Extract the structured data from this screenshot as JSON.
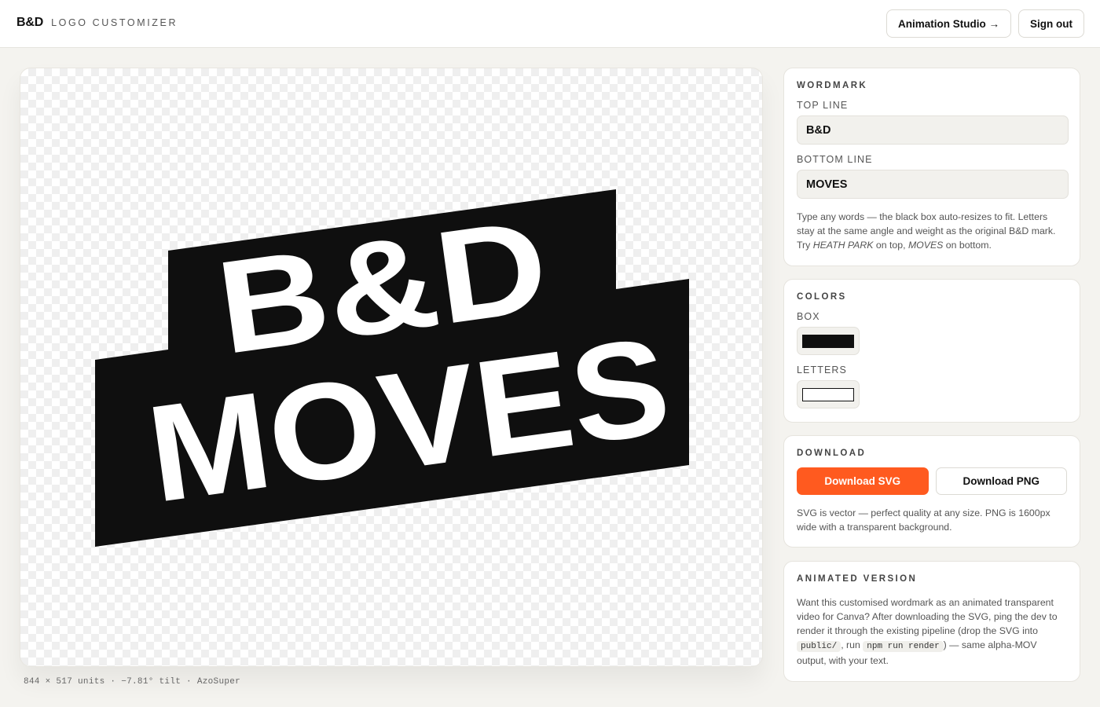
{
  "header": {
    "brand": "B&D",
    "subtitle": "LOGO CUSTOMIZER",
    "animation_studio_label": "Animation Studio →",
    "sign_out_label": "Sign out"
  },
  "canvas": {
    "top_line": "B&D",
    "bottom_line": "MOVES",
    "box_color": "#0f0f0f",
    "letter_color": "#ffffff",
    "meta": "844 × 517 units · −7.81° tilt · AzoSuper"
  },
  "wordmark": {
    "title": "WORDMARK",
    "top_label": "TOP LINE",
    "top_value": "B&D",
    "bottom_label": "BOTTOM LINE",
    "bottom_value": "MOVES",
    "help_1": "Type any words — the black box auto-resizes to fit. Letters stay at the same angle and weight as the original B&D mark. Try ",
    "help_example_top": "HEATH PARK",
    "help_2": " on top, ",
    "help_example_bottom": "MOVES",
    "help_3": " on bottom."
  },
  "colors": {
    "title": "COLORS",
    "box_label": "BOX",
    "box_value": "#0f0f0f",
    "letters_label": "LETTERS",
    "letters_value": "#ffffff"
  },
  "download": {
    "title": "DOWNLOAD",
    "svg_label": "Download SVG",
    "png_label": "Download PNG",
    "help": "SVG is vector — perfect quality at any size. PNG is 1600px wide with a transparent background.",
    "accent": "#ff5a1f"
  },
  "animated": {
    "title": "ANIMATED VERSION",
    "text_1": "Want this customised wordmark as an animated transparent video for Canva? After downloading the SVG, ping the dev to render it through the existing pipeline (drop the SVG into ",
    "code_1": "public/",
    "text_2": ", run ",
    "code_2": "npm run render",
    "text_3": ") — same alpha-MOV output, with your text."
  }
}
